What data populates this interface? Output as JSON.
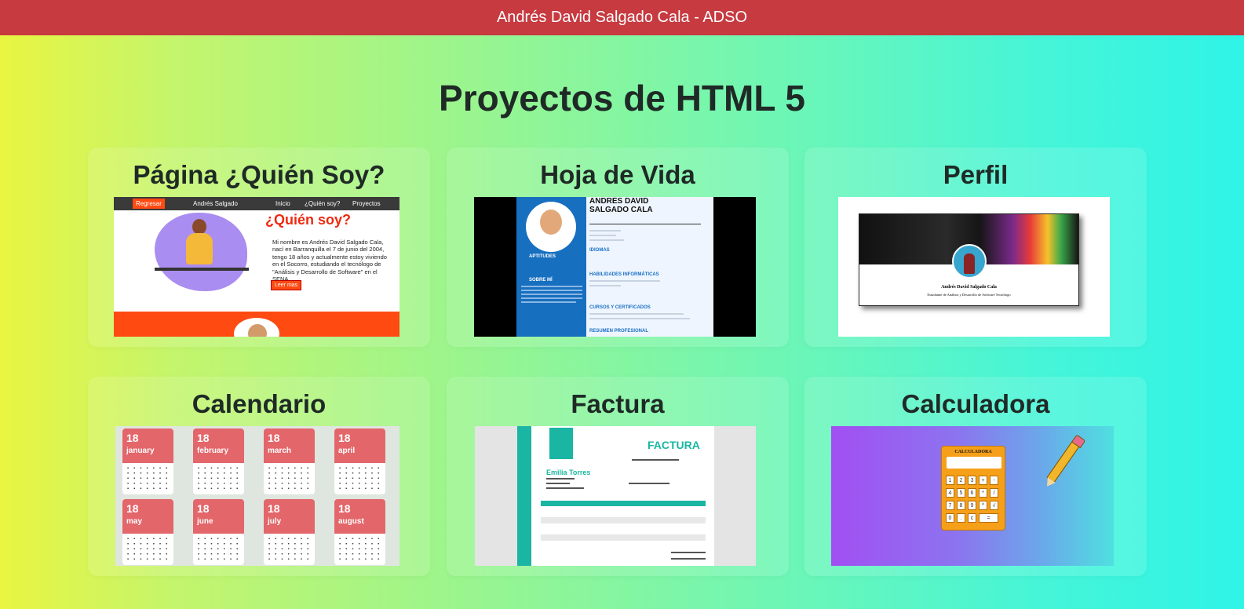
{
  "header": {
    "title": "Andrés David Salgado Cala - ADSO"
  },
  "main": {
    "title": "Proyectos de HTML 5"
  },
  "colors": {
    "header_bg": "#c63a40",
    "gradient_start": "#e9f541",
    "gradient_end": "#2ff4e6"
  },
  "projects": [
    {
      "title": "Página ¿Quién Soy?",
      "preview": {
        "nav_button": "Regresar",
        "nav_brand": "Andrés Salgado",
        "nav_links": [
          "Inicio",
          "¿Quién soy?",
          "Proyectos"
        ],
        "heading": "¿Quién soy?",
        "text": "Mi nombre es Andrés David Salgado Cala, nací en Barranquilla el 7 de junio del 2004, tengo 18 años y actualmente estoy viviendo en el Socorro, estudiando el tecnólogo de \"Análisis y Desarrollo de Software\" en el SENA.",
        "button": "Leer mas"
      }
    },
    {
      "title": "Hoja de Vida",
      "preview": {
        "name": "ANDRÉS DAVID SALGADO CALA",
        "sections_left": [
          "APTITUDES",
          "SOBRE MÍ"
        ],
        "sections_right": [
          "IDIOMAS",
          "HABILIDADES INFORMÁTICAS",
          "CURSOS Y CERTIFICADOS",
          "RESUMEN PROFESIONAL"
        ]
      }
    },
    {
      "title": "Perfil",
      "preview": {
        "name": "Andrés David Salgado Cala",
        "subtitle": "Estudiante de Análisis y Desarrollo de Software Tecnólogo"
      }
    },
    {
      "title": "Calendario",
      "preview": {
        "day": "18",
        "months": [
          "january",
          "february",
          "march",
          "april",
          "may",
          "june",
          "july",
          "august"
        ]
      }
    },
    {
      "title": "Factura",
      "preview": {
        "heading": "FACTURA",
        "client": "Emilia Torres"
      }
    },
    {
      "title": "Calculadora",
      "preview": {
        "label": "CALCULADORA",
        "keys": [
          "1",
          "2",
          "3",
          "+",
          "-",
          "4",
          "5",
          "6",
          "*",
          "/",
          "7",
          "8",
          "9",
          "^",
          "√",
          "0",
          ".",
          "c",
          "="
        ]
      }
    }
  ]
}
